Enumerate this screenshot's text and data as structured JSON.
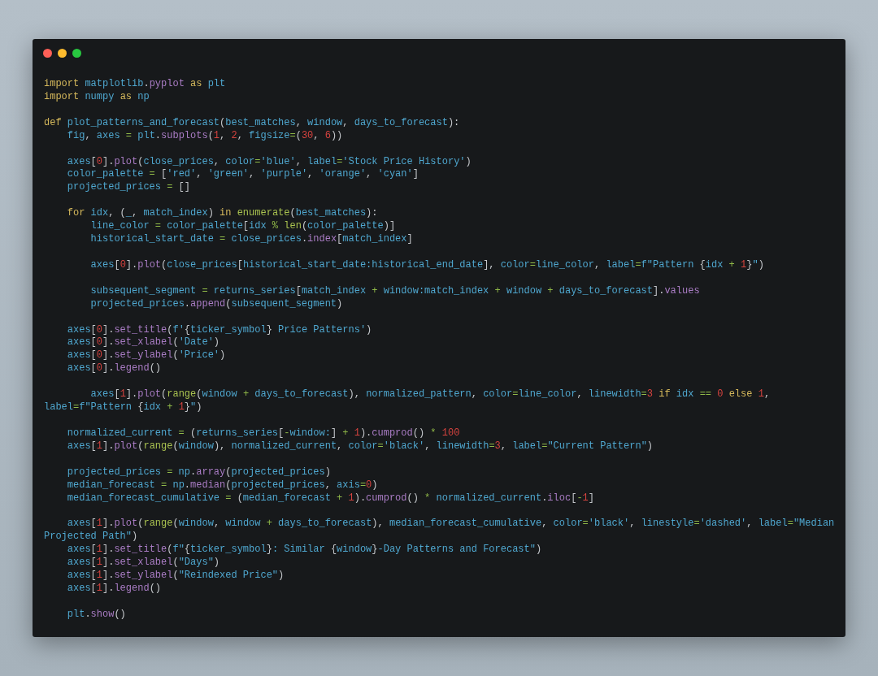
{
  "code_blocks": [
    [
      {
        "kind": "flush",
        "tokens": [
          {
            "kind": "kw",
            "text": "import"
          },
          {
            "kind": "id",
            "text": " matplotlib"
          },
          {
            "kind": "pun",
            "text": "."
          },
          {
            "kind": "fn",
            "text": "pyplot"
          },
          {
            "kind": "kw",
            "text": " as"
          },
          {
            "kind": "id",
            "text": " plt"
          }
        ]
      },
      {
        "kind": "flush",
        "tokens": [
          {
            "kind": "kw",
            "text": "import"
          },
          {
            "kind": "id",
            "text": " numpy"
          },
          {
            "kind": "kw",
            "text": " as"
          },
          {
            "kind": "id",
            "text": " np"
          }
        ]
      }
    ],
    [
      {
        "kind": "flush",
        "tokens": [
          {
            "kind": "kw",
            "text": "def"
          },
          {
            "kind": "id",
            "text": " plot_patterns_and_forecast"
          },
          {
            "kind": "pun",
            "text": "("
          },
          {
            "kind": "id",
            "text": "best_matches"
          },
          {
            "kind": "pun",
            "text": ", "
          },
          {
            "kind": "id",
            "text": "window"
          },
          {
            "kind": "pun",
            "text": ", "
          },
          {
            "kind": "id",
            "text": "days_to_forecast"
          },
          {
            "kind": "pun",
            "text": "):"
          }
        ]
      },
      {
        "kind": "body",
        "tokens": [
          {
            "kind": "id",
            "text": "fig"
          },
          {
            "kind": "pun",
            "text": ","
          },
          {
            "kind": "id",
            "text": " axes"
          },
          {
            "kind": "op",
            "text": " ="
          },
          {
            "kind": "id",
            "text": " plt"
          },
          {
            "kind": "pun",
            "text": "."
          },
          {
            "kind": "fn",
            "text": "subplots"
          },
          {
            "kind": "pun",
            "text": "("
          },
          {
            "kind": "num",
            "text": "1"
          },
          {
            "kind": "pun",
            "text": ", "
          },
          {
            "kind": "num",
            "text": "2"
          },
          {
            "kind": "pun",
            "text": ", "
          },
          {
            "kind": "id",
            "text": "figsize"
          },
          {
            "kind": "op",
            "text": "="
          },
          {
            "kind": "pun",
            "text": "("
          },
          {
            "kind": "num",
            "text": "30"
          },
          {
            "kind": "pun",
            "text": ", "
          },
          {
            "kind": "num",
            "text": "6"
          },
          {
            "kind": "pun",
            "text": "))"
          }
        ]
      }
    ],
    [
      {
        "kind": "body",
        "tokens": [
          {
            "kind": "id",
            "text": "axes"
          },
          {
            "kind": "pun",
            "text": "["
          },
          {
            "kind": "num",
            "text": "0"
          },
          {
            "kind": "pun",
            "text": "]."
          },
          {
            "kind": "fn",
            "text": "plot"
          },
          {
            "kind": "pun",
            "text": "("
          },
          {
            "kind": "id",
            "text": "close_prices"
          },
          {
            "kind": "pun",
            "text": ", "
          },
          {
            "kind": "id",
            "text": "color"
          },
          {
            "kind": "op",
            "text": "="
          },
          {
            "kind": "id",
            "text": "'blue'"
          },
          {
            "kind": "pun",
            "text": ", "
          },
          {
            "kind": "id",
            "text": "label"
          },
          {
            "kind": "op",
            "text": "="
          },
          {
            "kind": "id",
            "text": "'Stock Price History'"
          },
          {
            "kind": "pun",
            "text": ")"
          }
        ]
      },
      {
        "kind": "body",
        "tokens": [
          {
            "kind": "id",
            "text": "color_palette"
          },
          {
            "kind": "op",
            "text": " ="
          },
          {
            "kind": "pun",
            "text": " ["
          },
          {
            "kind": "id",
            "text": "'red'"
          },
          {
            "kind": "pun",
            "text": ", "
          },
          {
            "kind": "id",
            "text": "'green'"
          },
          {
            "kind": "pun",
            "text": ", "
          },
          {
            "kind": "id",
            "text": "'purple'"
          },
          {
            "kind": "pun",
            "text": ", "
          },
          {
            "kind": "id",
            "text": "'orange'"
          },
          {
            "kind": "pun",
            "text": ", "
          },
          {
            "kind": "id",
            "text": "'cyan'"
          },
          {
            "kind": "pun",
            "text": "]"
          }
        ]
      },
      {
        "kind": "body",
        "tokens": [
          {
            "kind": "id",
            "text": "projected_prices"
          },
          {
            "kind": "op",
            "text": " ="
          },
          {
            "kind": "pun",
            "text": " []"
          }
        ]
      }
    ],
    [
      {
        "kind": "body",
        "tokens": [
          {
            "kind": "kw",
            "text": "for"
          },
          {
            "kind": "id",
            "text": " idx"
          },
          {
            "kind": "pun",
            "text": ", ("
          },
          {
            "kind": "id",
            "text": "_"
          },
          {
            "kind": "pun",
            "text": ", "
          },
          {
            "kind": "id",
            "text": "match_index"
          },
          {
            "kind": "pun",
            "text": ")"
          },
          {
            "kind": "kw",
            "text": " in"
          },
          {
            "kind": "bi",
            "text": " enumerate"
          },
          {
            "kind": "pun",
            "text": "("
          },
          {
            "kind": "id",
            "text": "best_matches"
          },
          {
            "kind": "pun",
            "text": "):"
          }
        ]
      },
      {
        "kind": "nested",
        "tokens": [
          {
            "kind": "id",
            "text": "line_color"
          },
          {
            "kind": "op",
            "text": " ="
          },
          {
            "kind": "id",
            "text": " color_palette"
          },
          {
            "kind": "pun",
            "text": "["
          },
          {
            "kind": "id",
            "text": "idx"
          },
          {
            "kind": "op",
            "text": " %"
          },
          {
            "kind": "bi",
            "text": " len"
          },
          {
            "kind": "pun",
            "text": "("
          },
          {
            "kind": "id",
            "text": "color_palette"
          },
          {
            "kind": "pun",
            "text": ")]"
          }
        ]
      },
      {
        "kind": "nested",
        "tokens": [
          {
            "kind": "id",
            "text": "historical_start_date"
          },
          {
            "kind": "op",
            "text": " ="
          },
          {
            "kind": "id",
            "text": " close_prices"
          },
          {
            "kind": "pun",
            "text": "."
          },
          {
            "kind": "fn",
            "text": "index"
          },
          {
            "kind": "pun",
            "text": "["
          },
          {
            "kind": "id",
            "text": "match_index"
          },
          {
            "kind": "pun",
            "text": "]"
          }
        ]
      }
    ],
    [
      {
        "kind": "nested",
        "tokens": [
          {
            "kind": "id",
            "text": "axes"
          },
          {
            "kind": "pun",
            "text": "["
          },
          {
            "kind": "num",
            "text": "0"
          },
          {
            "kind": "pun",
            "text": "]."
          },
          {
            "kind": "fn",
            "text": "plot"
          },
          {
            "kind": "pun",
            "text": "("
          },
          {
            "kind": "id",
            "text": "close_prices"
          },
          {
            "kind": "pun",
            "text": "["
          },
          {
            "kind": "id",
            "text": "historical_start_date:historical_end_date"
          },
          {
            "kind": "pun",
            "text": "], "
          },
          {
            "kind": "id",
            "text": "color"
          },
          {
            "kind": "op",
            "text": "="
          },
          {
            "kind": "id",
            "text": "line_color"
          },
          {
            "kind": "pun",
            "text": ", "
          },
          {
            "kind": "id",
            "text": "label"
          },
          {
            "kind": "op",
            "text": "="
          },
          {
            "kind": "id",
            "text": "f\"Pattern "
          },
          {
            "kind": "pun",
            "text": "{"
          },
          {
            "kind": "id",
            "text": "idx"
          },
          {
            "kind": "op",
            "text": " +"
          },
          {
            "kind": "num",
            "text": " 1"
          },
          {
            "kind": "pun",
            "text": "}"
          },
          {
            "kind": "id",
            "text": "\""
          },
          {
            "kind": "pun",
            "text": ")"
          }
        ]
      }
    ],
    [
      {
        "kind": "nested",
        "tokens": [
          {
            "kind": "id",
            "text": "subsequent_segment"
          },
          {
            "kind": "op",
            "text": " ="
          },
          {
            "kind": "id",
            "text": " returns_series"
          },
          {
            "kind": "pun",
            "text": "["
          },
          {
            "kind": "id",
            "text": "match_index"
          },
          {
            "kind": "op",
            "text": " +"
          },
          {
            "kind": "id",
            "text": " window:match_index"
          },
          {
            "kind": "op",
            "text": " +"
          },
          {
            "kind": "id",
            "text": " window"
          },
          {
            "kind": "op",
            "text": " +"
          },
          {
            "kind": "id",
            "text": " days_to_forecast"
          },
          {
            "kind": "pun",
            "text": "]."
          },
          {
            "kind": "fn",
            "text": "values"
          }
        ]
      },
      {
        "kind": "nested",
        "tokens": [
          {
            "kind": "id",
            "text": "projected_prices"
          },
          {
            "kind": "pun",
            "text": "."
          },
          {
            "kind": "fn",
            "text": "append"
          },
          {
            "kind": "pun",
            "text": "("
          },
          {
            "kind": "id",
            "text": "subsequent_segment"
          },
          {
            "kind": "pun",
            "text": ")"
          }
        ]
      }
    ],
    [
      {
        "kind": "body",
        "tokens": [
          {
            "kind": "id",
            "text": "axes"
          },
          {
            "kind": "pun",
            "text": "["
          },
          {
            "kind": "num",
            "text": "0"
          },
          {
            "kind": "pun",
            "text": "]."
          },
          {
            "kind": "fn",
            "text": "set_title"
          },
          {
            "kind": "pun",
            "text": "("
          },
          {
            "kind": "id",
            "text": "f'"
          },
          {
            "kind": "pun",
            "text": "{"
          },
          {
            "kind": "id",
            "text": "ticker_symbol"
          },
          {
            "kind": "pun",
            "text": "}"
          },
          {
            "kind": "id",
            "text": " Price Patterns'"
          },
          {
            "kind": "pun",
            "text": ")"
          }
        ]
      },
      {
        "kind": "body",
        "tokens": [
          {
            "kind": "id",
            "text": "axes"
          },
          {
            "kind": "pun",
            "text": "["
          },
          {
            "kind": "num",
            "text": "0"
          },
          {
            "kind": "pun",
            "text": "]."
          },
          {
            "kind": "fn",
            "text": "set_xlabel"
          },
          {
            "kind": "pun",
            "text": "("
          },
          {
            "kind": "id",
            "text": "'Date'"
          },
          {
            "kind": "pun",
            "text": ")"
          }
        ]
      },
      {
        "kind": "body",
        "tokens": [
          {
            "kind": "id",
            "text": "axes"
          },
          {
            "kind": "pun",
            "text": "["
          },
          {
            "kind": "num",
            "text": "0"
          },
          {
            "kind": "pun",
            "text": "]."
          },
          {
            "kind": "fn",
            "text": "set_ylabel"
          },
          {
            "kind": "pun",
            "text": "("
          },
          {
            "kind": "id",
            "text": "'Price'"
          },
          {
            "kind": "pun",
            "text": ")"
          }
        ]
      },
      {
        "kind": "body",
        "tokens": [
          {
            "kind": "id",
            "text": "axes"
          },
          {
            "kind": "pun",
            "text": "["
          },
          {
            "kind": "num",
            "text": "0"
          },
          {
            "kind": "pun",
            "text": "]."
          },
          {
            "kind": "fn",
            "text": "legend"
          },
          {
            "kind": "pun",
            "text": "()"
          }
        ]
      }
    ],
    [
      {
        "kind": "nested",
        "tokens": [
          {
            "kind": "id",
            "text": "axes"
          },
          {
            "kind": "pun",
            "text": "["
          },
          {
            "kind": "num",
            "text": "1"
          },
          {
            "kind": "pun",
            "text": "]."
          },
          {
            "kind": "fn",
            "text": "plot"
          },
          {
            "kind": "pun",
            "text": "("
          },
          {
            "kind": "bi",
            "text": "range"
          },
          {
            "kind": "pun",
            "text": "("
          },
          {
            "kind": "id",
            "text": "window"
          },
          {
            "kind": "op",
            "text": " +"
          },
          {
            "kind": "id",
            "text": " days_to_forecast"
          },
          {
            "kind": "pun",
            "text": "), "
          },
          {
            "kind": "id",
            "text": "normalized_pattern"
          },
          {
            "kind": "pun",
            "text": ", "
          },
          {
            "kind": "id",
            "text": "color"
          },
          {
            "kind": "op",
            "text": "="
          },
          {
            "kind": "id",
            "text": "line_color"
          },
          {
            "kind": "pun",
            "text": ", "
          },
          {
            "kind": "id",
            "text": "linewidth"
          },
          {
            "kind": "op",
            "text": "="
          },
          {
            "kind": "num",
            "text": "3"
          },
          {
            "kind": "kw",
            "text": " if"
          },
          {
            "kind": "id",
            "text": " idx"
          },
          {
            "kind": "op",
            "text": " =="
          },
          {
            "kind": "num",
            "text": " 0"
          },
          {
            "kind": "kw",
            "text": " else"
          },
          {
            "kind": "num",
            "text": " 1"
          },
          {
            "kind": "pun",
            "text": ","
          }
        ]
      },
      {
        "kind": "flush",
        "tokens": [
          {
            "kind": "id",
            "text": "label"
          },
          {
            "kind": "op",
            "text": "="
          },
          {
            "kind": "id",
            "text": "f\"Pattern "
          },
          {
            "kind": "pun",
            "text": "{"
          },
          {
            "kind": "id",
            "text": "idx"
          },
          {
            "kind": "op",
            "text": " +"
          },
          {
            "kind": "num",
            "text": " 1"
          },
          {
            "kind": "pun",
            "text": "}"
          },
          {
            "kind": "id",
            "text": "\""
          },
          {
            "kind": "pun",
            "text": ")"
          }
        ]
      }
    ],
    [
      {
        "kind": "body",
        "tokens": [
          {
            "kind": "id",
            "text": "normalized_current"
          },
          {
            "kind": "op",
            "text": " ="
          },
          {
            "kind": "pun",
            "text": " ("
          },
          {
            "kind": "id",
            "text": "returns_series"
          },
          {
            "kind": "pun",
            "text": "["
          },
          {
            "kind": "op",
            "text": "-"
          },
          {
            "kind": "id",
            "text": "window:"
          },
          {
            "kind": "pun",
            "text": "]"
          },
          {
            "kind": "op",
            "text": " +"
          },
          {
            "kind": "num",
            "text": " 1"
          },
          {
            "kind": "pun",
            "text": ")."
          },
          {
            "kind": "fn",
            "text": "cumprod"
          },
          {
            "kind": "pun",
            "text": "()"
          },
          {
            "kind": "op",
            "text": " *"
          },
          {
            "kind": "num",
            "text": " 100"
          }
        ]
      },
      {
        "kind": "body",
        "tokens": [
          {
            "kind": "id",
            "text": "axes"
          },
          {
            "kind": "pun",
            "text": "["
          },
          {
            "kind": "num",
            "text": "1"
          },
          {
            "kind": "pun",
            "text": "]."
          },
          {
            "kind": "fn",
            "text": "plot"
          },
          {
            "kind": "pun",
            "text": "("
          },
          {
            "kind": "bi",
            "text": "range"
          },
          {
            "kind": "pun",
            "text": "("
          },
          {
            "kind": "id",
            "text": "window"
          },
          {
            "kind": "pun",
            "text": "), "
          },
          {
            "kind": "id",
            "text": "normalized_current"
          },
          {
            "kind": "pun",
            "text": ", "
          },
          {
            "kind": "id",
            "text": "color"
          },
          {
            "kind": "op",
            "text": "="
          },
          {
            "kind": "id",
            "text": "'black'"
          },
          {
            "kind": "pun",
            "text": ", "
          },
          {
            "kind": "id",
            "text": "linewidth"
          },
          {
            "kind": "op",
            "text": "="
          },
          {
            "kind": "num",
            "text": "3"
          },
          {
            "kind": "pun",
            "text": ", "
          },
          {
            "kind": "id",
            "text": "label"
          },
          {
            "kind": "op",
            "text": "="
          },
          {
            "kind": "id",
            "text": "\"Current Pattern\""
          },
          {
            "kind": "pun",
            "text": ")"
          }
        ]
      }
    ],
    [
      {
        "kind": "body",
        "tokens": [
          {
            "kind": "id",
            "text": "projected_prices"
          },
          {
            "kind": "op",
            "text": " ="
          },
          {
            "kind": "id",
            "text": " np"
          },
          {
            "kind": "pun",
            "text": "."
          },
          {
            "kind": "fn",
            "text": "array"
          },
          {
            "kind": "pun",
            "text": "("
          },
          {
            "kind": "id",
            "text": "projected_prices"
          },
          {
            "kind": "pun",
            "text": ")"
          }
        ]
      },
      {
        "kind": "body",
        "tokens": [
          {
            "kind": "id",
            "text": "median_forecast"
          },
          {
            "kind": "op",
            "text": " ="
          },
          {
            "kind": "id",
            "text": " np"
          },
          {
            "kind": "pun",
            "text": "."
          },
          {
            "kind": "fn",
            "text": "median"
          },
          {
            "kind": "pun",
            "text": "("
          },
          {
            "kind": "id",
            "text": "projected_prices"
          },
          {
            "kind": "pun",
            "text": ", "
          },
          {
            "kind": "id",
            "text": "axis"
          },
          {
            "kind": "op",
            "text": "="
          },
          {
            "kind": "num",
            "text": "0"
          },
          {
            "kind": "pun",
            "text": ")"
          }
        ]
      },
      {
        "kind": "body",
        "tokens": [
          {
            "kind": "id",
            "text": "median_forecast_cumulative"
          },
          {
            "kind": "op",
            "text": " ="
          },
          {
            "kind": "pun",
            "text": " ("
          },
          {
            "kind": "id",
            "text": "median_forecast"
          },
          {
            "kind": "op",
            "text": " +"
          },
          {
            "kind": "num",
            "text": " 1"
          },
          {
            "kind": "pun",
            "text": ")."
          },
          {
            "kind": "fn",
            "text": "cumprod"
          },
          {
            "kind": "pun",
            "text": "()"
          },
          {
            "kind": "op",
            "text": " *"
          },
          {
            "kind": "id",
            "text": " normalized_current"
          },
          {
            "kind": "pun",
            "text": "."
          },
          {
            "kind": "fn",
            "text": "iloc"
          },
          {
            "kind": "pun",
            "text": "["
          },
          {
            "kind": "op",
            "text": "-"
          },
          {
            "kind": "num",
            "text": "1"
          },
          {
            "kind": "pun",
            "text": "]"
          }
        ]
      }
    ],
    [
      {
        "kind": "body",
        "tokens": [
          {
            "kind": "id",
            "text": "axes"
          },
          {
            "kind": "pun",
            "text": "["
          },
          {
            "kind": "num",
            "text": "1"
          },
          {
            "kind": "pun",
            "text": "]."
          },
          {
            "kind": "fn",
            "text": "plot"
          },
          {
            "kind": "pun",
            "text": "("
          },
          {
            "kind": "bi",
            "text": "range"
          },
          {
            "kind": "pun",
            "text": "("
          },
          {
            "kind": "id",
            "text": "window"
          },
          {
            "kind": "pun",
            "text": ", "
          },
          {
            "kind": "id",
            "text": "window"
          },
          {
            "kind": "op",
            "text": " +"
          },
          {
            "kind": "id",
            "text": " days_to_forecast"
          },
          {
            "kind": "pun",
            "text": "), "
          },
          {
            "kind": "id",
            "text": "median_forecast_cumulative"
          },
          {
            "kind": "pun",
            "text": ", "
          },
          {
            "kind": "id",
            "text": "color"
          },
          {
            "kind": "op",
            "text": "="
          },
          {
            "kind": "id",
            "text": "'black'"
          },
          {
            "kind": "pun",
            "text": ", "
          },
          {
            "kind": "id",
            "text": "linestyle"
          },
          {
            "kind": "op",
            "text": "="
          },
          {
            "kind": "id",
            "text": "'dashed'"
          },
          {
            "kind": "pun",
            "text": ", "
          },
          {
            "kind": "id",
            "text": "label"
          },
          {
            "kind": "op",
            "text": "="
          },
          {
            "kind": "id",
            "text": "\"Median"
          }
        ]
      },
      {
        "kind": "flush",
        "tokens": [
          {
            "kind": "id",
            "text": "Projected Path\""
          },
          {
            "kind": "pun",
            "text": ")"
          }
        ]
      },
      {
        "kind": "body",
        "tokens": [
          {
            "kind": "id",
            "text": "axes"
          },
          {
            "kind": "pun",
            "text": "["
          },
          {
            "kind": "num",
            "text": "1"
          },
          {
            "kind": "pun",
            "text": "]."
          },
          {
            "kind": "fn",
            "text": "set_title"
          },
          {
            "kind": "pun",
            "text": "("
          },
          {
            "kind": "id",
            "text": "f\""
          },
          {
            "kind": "pun",
            "text": "{"
          },
          {
            "kind": "id",
            "text": "ticker_symbol"
          },
          {
            "kind": "pun",
            "text": "}"
          },
          {
            "kind": "id",
            "text": ": Similar "
          },
          {
            "kind": "pun",
            "text": "{"
          },
          {
            "kind": "id",
            "text": "window"
          },
          {
            "kind": "pun",
            "text": "}"
          },
          {
            "kind": "id",
            "text": "-Day Patterns and Forecast\""
          },
          {
            "kind": "pun",
            "text": ")"
          }
        ]
      },
      {
        "kind": "body",
        "tokens": [
          {
            "kind": "id",
            "text": "axes"
          },
          {
            "kind": "pun",
            "text": "["
          },
          {
            "kind": "num",
            "text": "1"
          },
          {
            "kind": "pun",
            "text": "]."
          },
          {
            "kind": "fn",
            "text": "set_xlabel"
          },
          {
            "kind": "pun",
            "text": "("
          },
          {
            "kind": "id",
            "text": "\"Days\""
          },
          {
            "kind": "pun",
            "text": ")"
          }
        ]
      },
      {
        "kind": "body",
        "tokens": [
          {
            "kind": "id",
            "text": "axes"
          },
          {
            "kind": "pun",
            "text": "["
          },
          {
            "kind": "num",
            "text": "1"
          },
          {
            "kind": "pun",
            "text": "]."
          },
          {
            "kind": "fn",
            "text": "set_ylabel"
          },
          {
            "kind": "pun",
            "text": "("
          },
          {
            "kind": "id",
            "text": "\"Reindexed Price\""
          },
          {
            "kind": "pun",
            "text": ")"
          }
        ]
      },
      {
        "kind": "body",
        "tokens": [
          {
            "kind": "id",
            "text": "axes"
          },
          {
            "kind": "pun",
            "text": "["
          },
          {
            "kind": "num",
            "text": "1"
          },
          {
            "kind": "pun",
            "text": "]."
          },
          {
            "kind": "fn",
            "text": "legend"
          },
          {
            "kind": "pun",
            "text": "()"
          }
        ]
      }
    ],
    [
      {
        "kind": "body",
        "tokens": [
          {
            "kind": "id",
            "text": "plt"
          },
          {
            "kind": "pun",
            "text": "."
          },
          {
            "kind": "fn",
            "text": "show"
          },
          {
            "kind": "pun",
            "text": "()"
          }
        ]
      }
    ]
  ]
}
